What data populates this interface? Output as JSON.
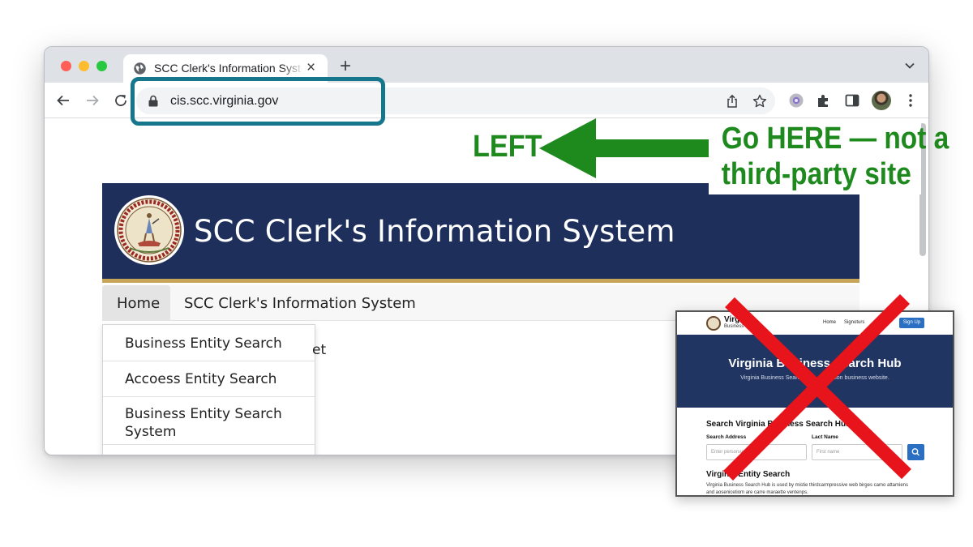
{
  "browser": {
    "tab_title": "SCC Clerk's Information System",
    "tab_close": "×",
    "new_tab": "+",
    "url": "cis.scc.virginia.gov",
    "icons": [
      "globe-icon",
      "back-icon",
      "forward-icon",
      "reload-icon",
      "lock-icon",
      "share-icon",
      "star-icon",
      "extension-icon",
      "puzzle-icon",
      "sidepanel-icon",
      "avatar",
      "menu-icon",
      "chevron-down-icon"
    ]
  },
  "site": {
    "title": "SCC Clerk's Information System",
    "nav": {
      "home": "Home",
      "title_link": "SCC Clerk's Information System"
    },
    "dropdown": [
      "Business Entity Search",
      "Accoess Entity Search",
      "Business Entity Search System"
    ],
    "peek_text": "et",
    "colors": {
      "banner": "#1f2f5b",
      "stripe": "#c9a55a"
    }
  },
  "annotations": {
    "left_label": "LEFT",
    "callout_line1": "Go HERE — not a",
    "callout_line2": "third-party site",
    "colors": {
      "green": "#1e8a1e",
      "highlight": "#16778c",
      "red_x": "#e8141c"
    }
  },
  "fake_site": {
    "brand": "Virgi",
    "brand_sub": "Business ...",
    "nav": [
      "Home",
      "Signoturs"
    ],
    "signup": "Sign Up",
    "hero_title": "Virginia Business Search Hub",
    "hero_sub": "Virginia Business Search Hub ... position business website.",
    "search_heading": "Search Virginia Business Search Hub",
    "label_address": "Search Address",
    "label_last": "Lact Name",
    "placeholder_1": "Enter personam",
    "placeholder_2": "First name",
    "section_heading": "Virginia Entity Search",
    "para_line1": "Virginia Business Search Hub is used by mistie thirdcarmpressive web birges camo attamiens",
    "para_line2": "and aosenicetiom are carre maraette ventenps."
  }
}
